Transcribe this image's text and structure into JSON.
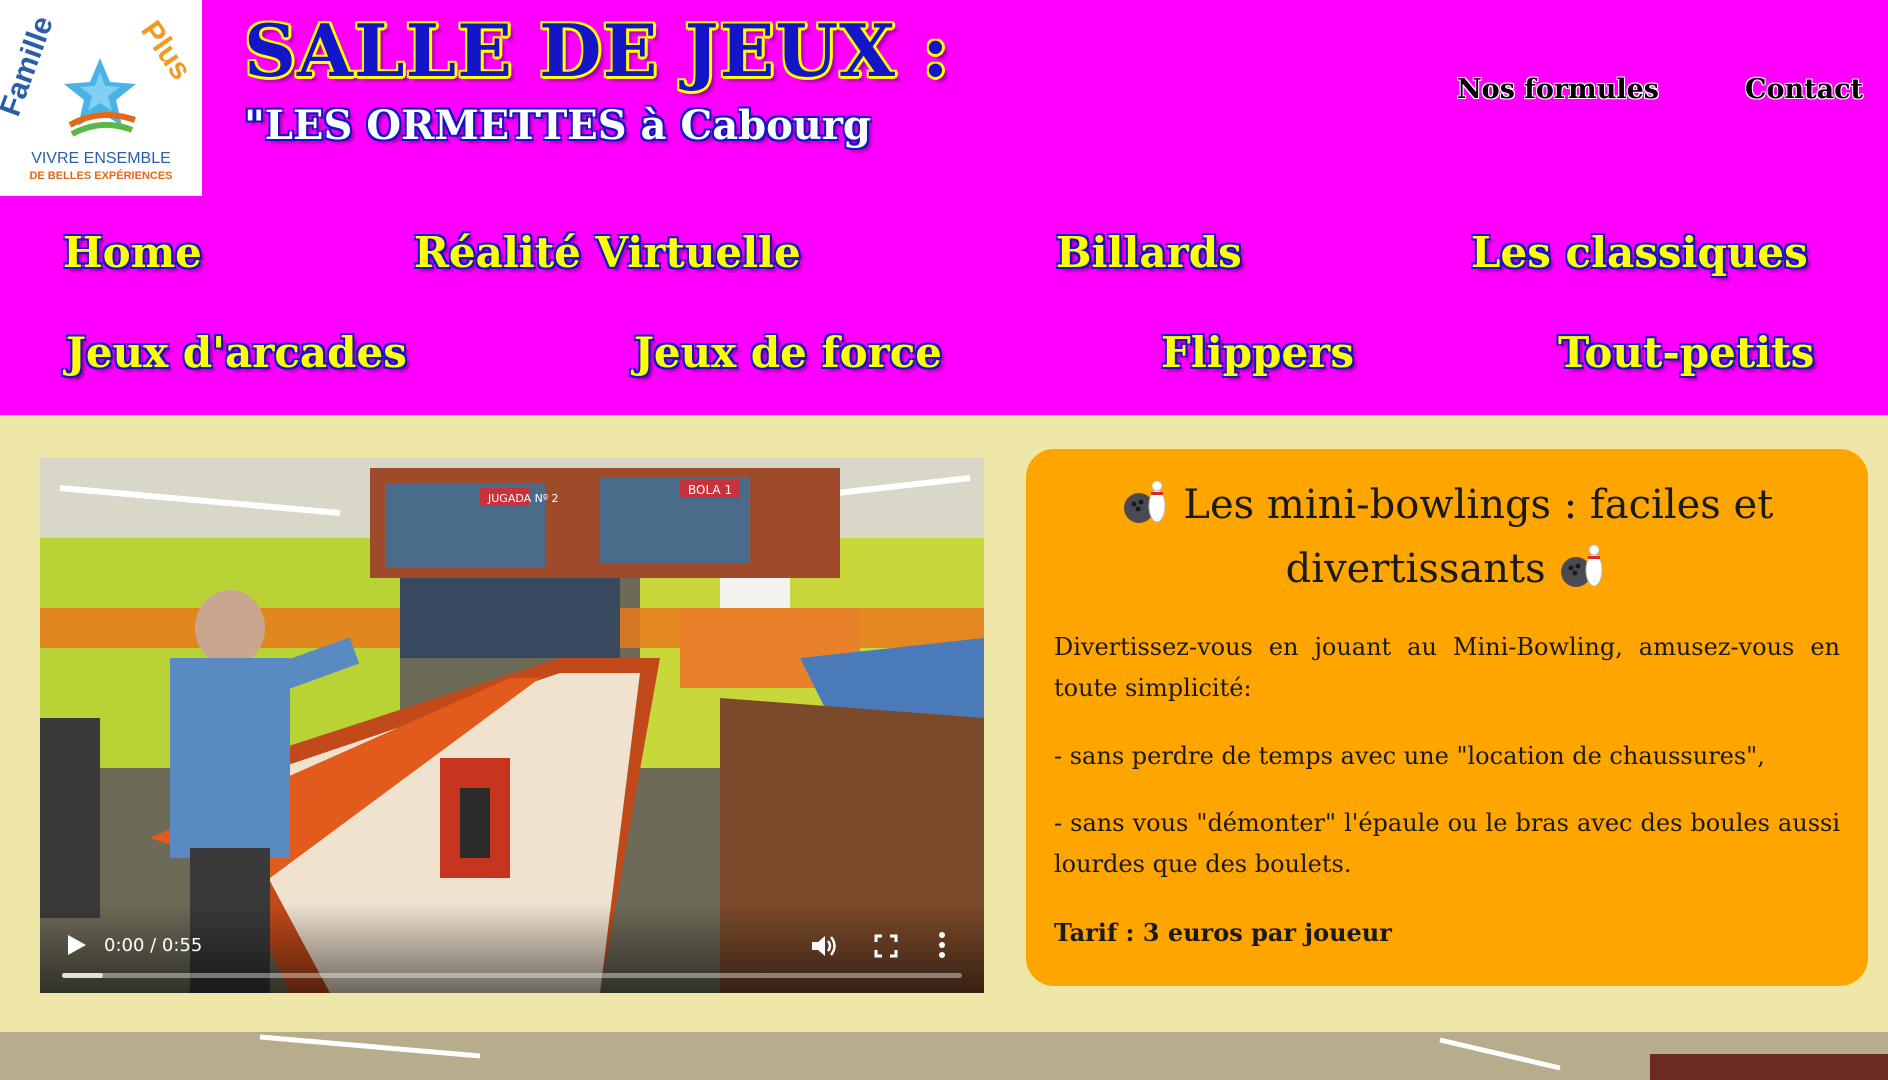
{
  "header": {
    "logo_text_top": "Famille Plus",
    "logo_line1": "VIVRE ENSEMBLE",
    "logo_line2": "DE BELLES EXPÉRIENCES",
    "title": "SALLE DE JEUX :",
    "subtitle": "\"LES ORMETTES à Cabourg",
    "top_links": [
      "Nos formules",
      "Contact"
    ]
  },
  "nav": {
    "row1": [
      "Home",
      "Réalité Virtuelle",
      "Billards",
      "Les classiques"
    ],
    "row2": [
      "Jeux d'arcades",
      "Jeux de force",
      "Flippers",
      "Tout-petits"
    ]
  },
  "video": {
    "time": "0:00 / 0:55",
    "buffered_fraction": 0.045,
    "screen_text_left": "JUGADA Nº 2",
    "screen_text_right": "BOLA 1"
  },
  "card": {
    "title_line1": "Les mini-bowlings : faciles et",
    "title_line2": "divertissants",
    "paragraphs": [
      "Divertissez-vous en jouant au Mini-Bowling, amusez-vous en toute simplicité:",
      "- sans perdre de temps avec une \"location de chaussures\",",
      "- sans vous \"démonter\" l'épaule ou le bras avec des boules aussi lourdes que des boulets.",
      "Tarif : 3 euros par joueur"
    ]
  },
  "colors": {
    "header_bg": "#ff00ff",
    "page_bg": "#efe7a8",
    "card_bg": "#ffa500",
    "nav_text": "#ffff00",
    "nav_outline": "#1414c8"
  }
}
